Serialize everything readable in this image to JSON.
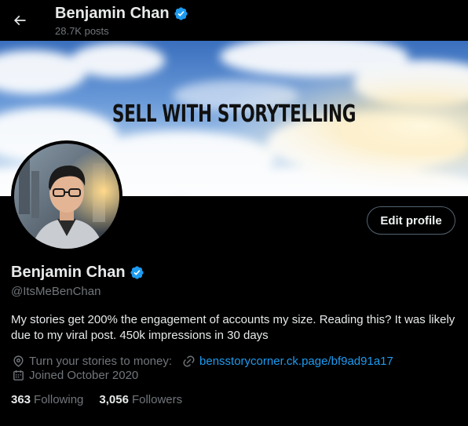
{
  "header": {
    "name": "Benjamin Chan",
    "posts_count": "28.7K posts"
  },
  "banner": {
    "headline": "SELL WITH STORYTELLING"
  },
  "profile": {
    "edit_label": "Edit profile",
    "name": "Benjamin Chan",
    "handle": "@ItsMeBenChan",
    "bio": "My stories get 200% the engagement of accounts my size. Reading this? It was likely due to my viral post. 450k impressions in 30 days",
    "location": "Turn your stories to money:",
    "website": "bensstorycorner.ck.page/bf9ad91a17",
    "joined": "Joined October 2020",
    "following_count": "363",
    "following_label": "Following",
    "followers_count": "3,056",
    "followers_label": "Followers"
  },
  "icons": {
    "back": "arrow-left-icon",
    "verified": "verified-badge-icon",
    "location": "location-pin-icon",
    "link": "link-icon",
    "calendar": "calendar-icon"
  },
  "colors": {
    "background": "#000000",
    "accent": "#1d9bf0",
    "text": "#e7e9ea",
    "muted": "#71767b",
    "border": "#536471"
  }
}
